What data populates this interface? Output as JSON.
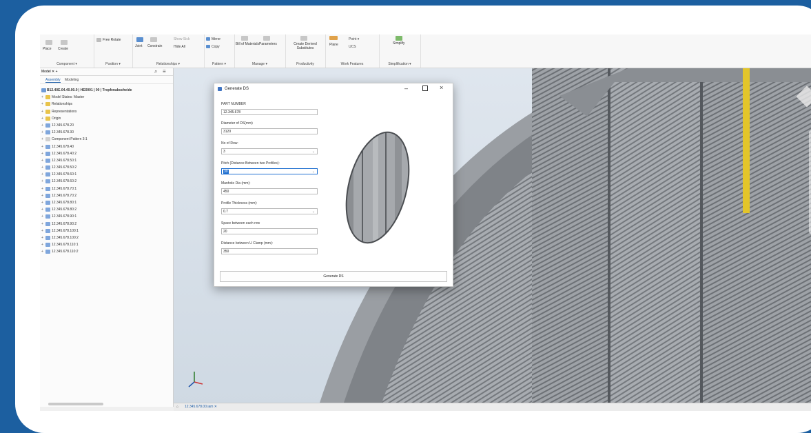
{
  "ribbon": {
    "groups": [
      {
        "label": "Component ▾",
        "buttons": [
          "Place",
          "Create"
        ]
      },
      {
        "label": "Position ▾",
        "buttons": [
          "Free Rotate"
        ]
      },
      {
        "label": "Relationships ▾",
        "buttons": [
          "Joint",
          "Constrain",
          "Show Sick",
          "Hide All"
        ]
      },
      {
        "label": "Pattern ▾",
        "buttons": [
          "Mirror",
          "Copy"
        ]
      },
      {
        "label": "Manage ▾",
        "buttons": [
          "Bill of Materials",
          "Parameters"
        ]
      },
      {
        "label": "Productivity",
        "buttons": [
          "Create Derived Substitutes"
        ]
      },
      {
        "label": "Work Features",
        "buttons": [
          "Plane",
          "Point ▾",
          "UCS"
        ]
      },
      {
        "label": "Simplification ▾",
        "buttons": [
          "Simplify"
        ]
      }
    ]
  },
  "browser": {
    "tab_label": "Model ✕ +",
    "subtabs": [
      "Assembly",
      "Modeling"
    ],
    "root": "B12.40E.04.40.00.0 | HE0001 | 00 | Tropfenabscheide",
    "items": [
      "Model States: Master",
      "Relationships",
      "Representations",
      "Origin",
      "12.345.678.20",
      "12.345.678.30",
      "Component Pattern 3:1",
      "12.345.678.40",
      "12.345.678.40:2",
      "12.345.678.50:1",
      "12.345.678.50:2",
      "12.345.678.60:1",
      "12.345.678.60:2",
      "12.345.678.70:1",
      "12.345.678.70:2",
      "12.345.678.80:1",
      "12.345.678.80:2",
      "12.345.678.90:1",
      "12.345.678.90:2",
      "12.345.678.100:1",
      "12.345.678.100:2",
      "12.345.678.110:1",
      "12.345.678.110:2"
    ]
  },
  "dialog": {
    "title": "Generate DS",
    "fields": {
      "part_number": {
        "label": "PART NUMBER",
        "value": "12.345.678"
      },
      "diameter": {
        "label": "Diameter of DS(mm)",
        "value": "3120"
      },
      "rows": {
        "label": "No of Row:",
        "value": "3"
      },
      "pitch": {
        "label": "Pitch (Distance Between two Profiles):",
        "value": "30"
      },
      "manhole": {
        "label": "Manhole Dia (mm):",
        "value": "450"
      },
      "thickness": {
        "label": "Profile Thickness (mm):",
        "value": "0.7"
      },
      "space": {
        "label": "Space between each row",
        "value": "20"
      },
      "clamp": {
        "label": "Distance between U Clamp (mm):",
        "value": "350"
      }
    },
    "generate_label": "Generate DS"
  },
  "statusbar": {
    "document_tab": "12.345.678.00.iam ✕"
  },
  "colors": {
    "frame": "#1c5fa0",
    "accent": "#1f5fa8",
    "highlight": "#1f6fd0",
    "model_steel": "#8f9398",
    "yellow": "#e3c52a"
  }
}
